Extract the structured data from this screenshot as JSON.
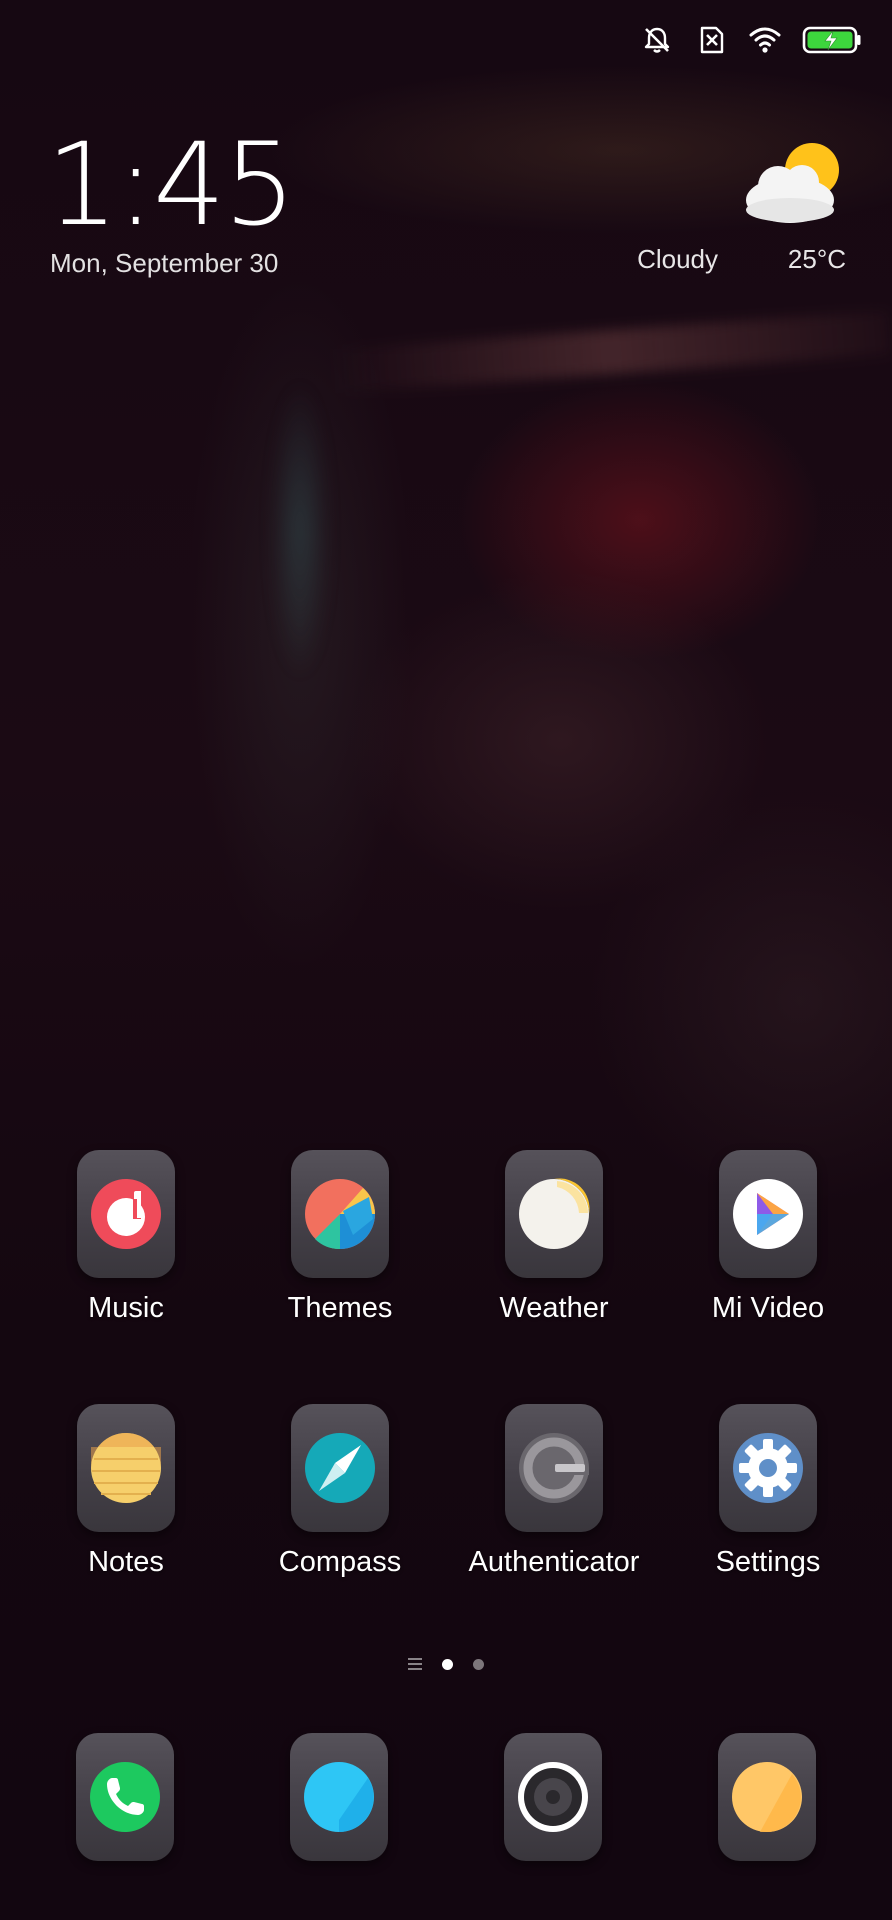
{
  "status_bar": {
    "icons": [
      "silent-notifications-icon",
      "no-sim-icon",
      "wifi-icon",
      "battery-charging-icon"
    ]
  },
  "clock_widget": {
    "time": "1:45",
    "date": "Mon, September 30"
  },
  "weather_widget": {
    "icon": "cloudy-sun-icon",
    "condition": "Cloudy",
    "temperature": "25°C"
  },
  "apps": {
    "row1": [
      {
        "label": "Music",
        "icon": "music-icon"
      },
      {
        "label": "Themes",
        "icon": "themes-icon"
      },
      {
        "label": "Weather",
        "icon": "weather-icon"
      },
      {
        "label": "Mi Video",
        "icon": "mi-video-icon"
      }
    ],
    "row2": [
      {
        "label": "Notes",
        "icon": "notes-icon"
      },
      {
        "label": "Compass",
        "icon": "compass-icon"
      },
      {
        "label": "Authenticator",
        "icon": "authenticator-icon"
      },
      {
        "label": "Settings",
        "icon": "gear-icon"
      }
    ]
  },
  "page_indicator": {
    "pages": 2,
    "active_page": 1
  },
  "dock": [
    {
      "icon": "phone-icon"
    },
    {
      "icon": "browser-icon"
    },
    {
      "icon": "camera-icon"
    },
    {
      "icon": "gallery-icon"
    }
  ],
  "colors": {
    "music_red": "#EF4B5A",
    "phone_green": "#1DC95F",
    "browser_blue": "#2EC6F5",
    "gallery_yellow": "#FFC767",
    "compass_teal": "#15A9B8",
    "notes_yellow": "#F6CF6B"
  }
}
